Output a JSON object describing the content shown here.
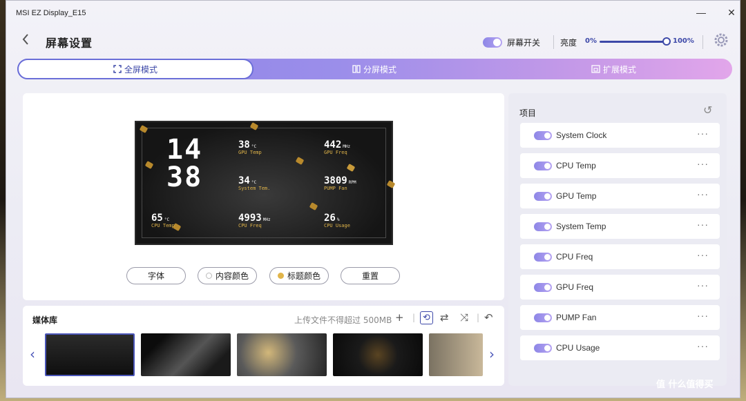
{
  "window": {
    "title": "MSI EZ Display_E15",
    "minimize": "—",
    "maximize": "☐",
    "close": "✕"
  },
  "header": {
    "back_icon": "chevron-left-icon",
    "title": "屏幕设置",
    "screen_switch_label": "屏幕开关",
    "brightness_label": "亮度",
    "brightness_min": "0%",
    "brightness_max": "100%",
    "brightness_value": 1.0,
    "settings_icon": "gear-icon"
  },
  "mode_tabs": [
    {
      "label": "全屏模式",
      "icon": "fullscreen-icon",
      "active": true
    },
    {
      "label": "分屏模式",
      "icon": "split-screen-icon",
      "active": false
    },
    {
      "label": "扩展模式",
      "icon": "extend-icon",
      "active": false
    }
  ],
  "preview": {
    "time_hour": "14",
    "time_minute": "38",
    "metrics": [
      {
        "value": "38",
        "unit": "°C",
        "label": "GPU Temp"
      },
      {
        "value": "442",
        "unit": "MHz",
        "label": "GPU Freq"
      },
      {
        "value": "34",
        "unit": "°C",
        "label": "System Tem."
      },
      {
        "value": "3809",
        "unit": "RPM",
        "label": "PUMP Fan"
      },
      {
        "value": "65",
        "unit": "°C",
        "label": "CPU Temp"
      },
      {
        "value": "4993",
        "unit": "MHz",
        "label": "CPU Freq"
      },
      {
        "value": "26",
        "unit": "%",
        "label": "CPU Usage"
      }
    ],
    "buttons": {
      "font": "字体",
      "content_color": "内容颜色",
      "title_color": "标题颜色",
      "reset": "重置"
    },
    "content_color_swatch": "#ffffff",
    "title_color_swatch": "#e1b54a"
  },
  "media": {
    "title": "媒体库",
    "hint": "上传文件不得超过 500MB",
    "icons": [
      "add-icon",
      "loop-one-icon",
      "loop-icon",
      "shuffle-icon",
      "undo-icon"
    ],
    "selected_index": 0
  },
  "items": {
    "title": "项目",
    "list": [
      "System Clock",
      "CPU Temp",
      "GPU Temp",
      "System Temp",
      "CPU Freq",
      "GPU Freq",
      "PUMP Fan",
      "CPU Usage"
    ]
  },
  "watermark": "值 什么值得买"
}
